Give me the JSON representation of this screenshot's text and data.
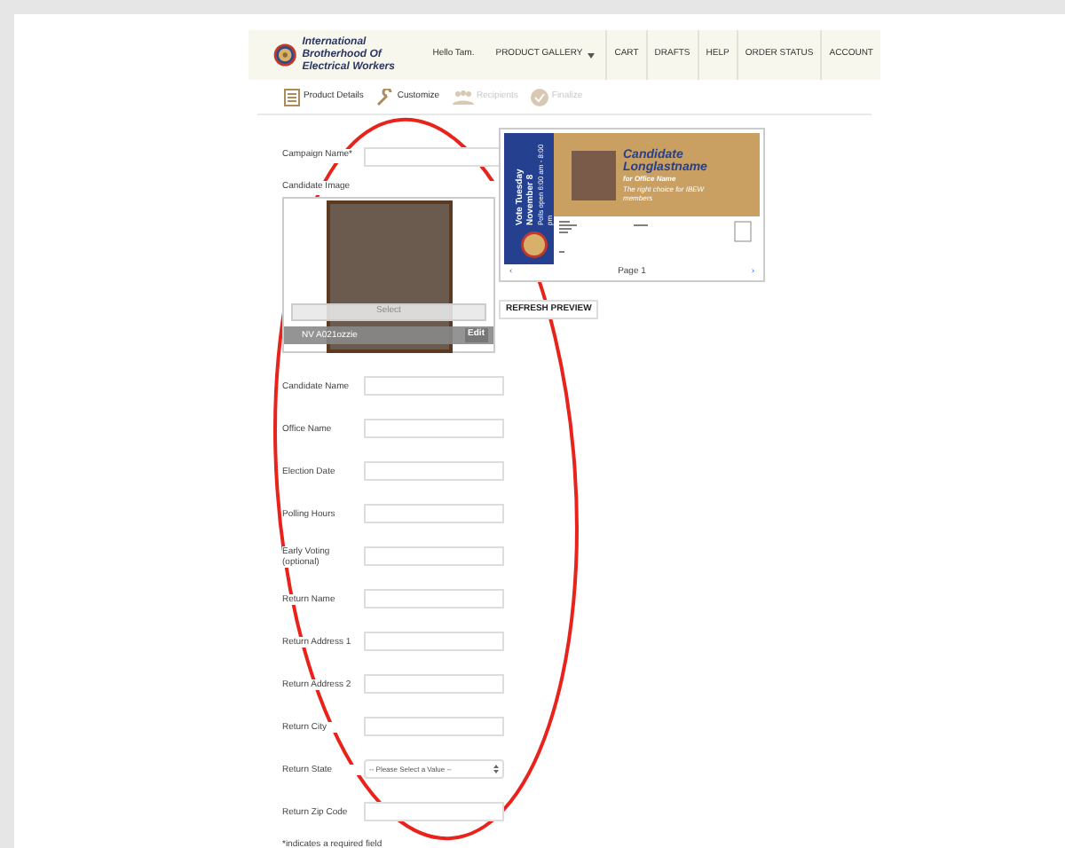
{
  "header": {
    "org_name": "International Brotherhood Of Electrical Workers",
    "greeting": "Hello Tam.",
    "nav": [
      {
        "label": "PRODUCT GALLERY",
        "dropdown": true
      },
      {
        "label": "CART",
        "dropdown": false
      },
      {
        "label": "DRAFTS",
        "dropdown": false
      },
      {
        "label": "HELP",
        "dropdown": false
      },
      {
        "label": "ORDER STATUS",
        "dropdown": false
      },
      {
        "label": "ACCOUNT",
        "dropdown": false
      }
    ]
  },
  "steps": [
    {
      "label": "Product Details",
      "kind": "details",
      "disabled": false
    },
    {
      "label": "Customize",
      "kind": "customize",
      "disabled": false
    },
    {
      "label": "Recipients",
      "kind": "recipients",
      "disabled": true
    },
    {
      "label": "Finalize",
      "kind": "finalize",
      "disabled": true
    }
  ],
  "form": {
    "campaign_name": {
      "label": "Campaign Name*"
    },
    "candidate_image": {
      "label": "Candidate Image",
      "select_label": "Select",
      "file_name": "NV A021ozzie",
      "edit_label": "Edit"
    },
    "fields": [
      {
        "label": "Candidate Name",
        "kind": "text"
      },
      {
        "label": "Office Name",
        "kind": "text"
      },
      {
        "label": "Election Date",
        "kind": "text"
      },
      {
        "label": "Polling Hours",
        "kind": "text"
      },
      {
        "label": "Early Voting (optional)",
        "kind": "text"
      },
      {
        "label": "Return Name",
        "kind": "text"
      },
      {
        "label": "Return Address 1",
        "kind": "text"
      },
      {
        "label": "Return Address 2",
        "kind": "text"
      },
      {
        "label": "Return City",
        "kind": "text"
      },
      {
        "label": "Return State",
        "kind": "select",
        "value": "-- Please Select a Value --"
      },
      {
        "label": "Return Zip Code",
        "kind": "text"
      }
    ],
    "note": "*indicates a required field"
  },
  "preview": {
    "vote_day": "Vote Tuesday November 8",
    "polls": "Polls open 6:00 am - 8:00 pm",
    "candidate": "Candidate Longlastname",
    "office": "for Office Name",
    "slogan": "The right choice for IBEW members",
    "prev": "‹",
    "page_label": "Page 1",
    "next": "›",
    "refresh_label": "REFRESH PREVIEW"
  }
}
